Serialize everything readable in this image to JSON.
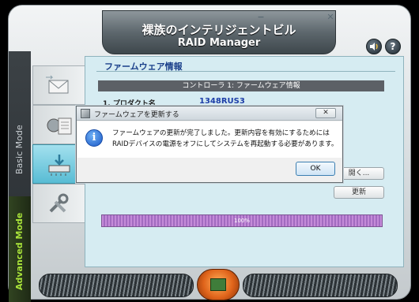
{
  "app": {
    "title_jp": "裸族のインテリジェントビル",
    "title_en": "RAID Manager"
  },
  "window_controls": {
    "minimize": "−",
    "close": "✕"
  },
  "header_buttons": {
    "sound_icon": "speaker-icon",
    "help_label": "?"
  },
  "modes": {
    "basic": "Basic Mode",
    "advanced": "Advanced Mode"
  },
  "nav": {
    "items": [
      {
        "icon": "mail-icon"
      },
      {
        "icon": "controller-icon"
      },
      {
        "icon": "firmware-download-icon"
      },
      {
        "icon": "tools-icon"
      }
    ],
    "active_index": 2
  },
  "content": {
    "section_title": "ファームウェア情報",
    "controller_header": "コントローラ 1: ファームウェア情報",
    "product_label": "1.  プロダクト名",
    "product_value": "1348RUS3",
    "browse_button": "開く...",
    "update_button": "更新",
    "progress_label": "100%",
    "progress_fraction": 1.0
  },
  "dialog": {
    "title": "ファームウェアを更新する",
    "close_label": "✕",
    "message": "ファームウェアの更新が完了しました。更新内容を有効にするためにはRAIDデバイスの電源をオフにしてシステムを再起動する必要があります。",
    "ok_label": "OK",
    "icon": "info-icon"
  },
  "colors": {
    "accent_cyan": "#58bcd4",
    "advanced_green": "#a8e23a",
    "progress_purple": "#c48ad8",
    "title_blue": "#1a3f8a"
  }
}
